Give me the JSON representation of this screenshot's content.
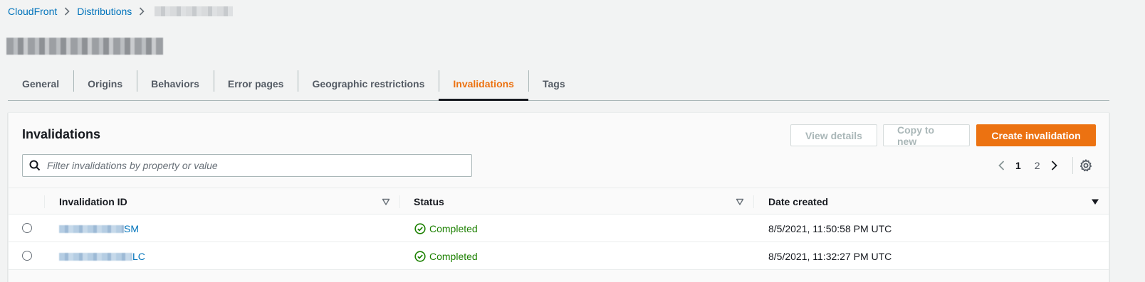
{
  "breadcrumb": {
    "items": [
      "CloudFront",
      "Distributions"
    ]
  },
  "tabs": [
    {
      "label": "General",
      "active": false
    },
    {
      "label": "Origins",
      "active": false
    },
    {
      "label": "Behaviors",
      "active": false
    },
    {
      "label": "Error pages",
      "active": false
    },
    {
      "label": "Geographic restrictions",
      "active": false
    },
    {
      "label": "Invalidations",
      "active": true
    },
    {
      "label": "Tags",
      "active": false
    }
  ],
  "panel": {
    "title": "Invalidations",
    "buttons": {
      "view_details": "View details",
      "copy_to_new": "Copy to new",
      "create": "Create invalidation"
    },
    "search": {
      "placeholder": "Filter invalidations by property or value",
      "value": ""
    },
    "pagination": {
      "pages": [
        "1",
        "2"
      ],
      "current": "1"
    }
  },
  "table": {
    "columns": [
      "Invalidation ID",
      "Status",
      "Date created"
    ],
    "rows": [
      {
        "id_suffix": "SM",
        "status": "Completed",
        "date": "8/5/2021, 11:50:58 PM UTC"
      },
      {
        "id_suffix": "LC",
        "status": "Completed",
        "date": "8/5/2021, 11:32:27 PM UTC"
      }
    ]
  },
  "colors": {
    "accent": "#ec7211",
    "link": "#0073bb",
    "success": "#1d8102",
    "background": "#f2f3f3"
  },
  "icons": [
    "chevron-right-icon",
    "search-icon",
    "chevron-left-icon",
    "gear-icon",
    "filter-triangle-icon",
    "sort-down-icon",
    "check-circle-icon"
  ]
}
